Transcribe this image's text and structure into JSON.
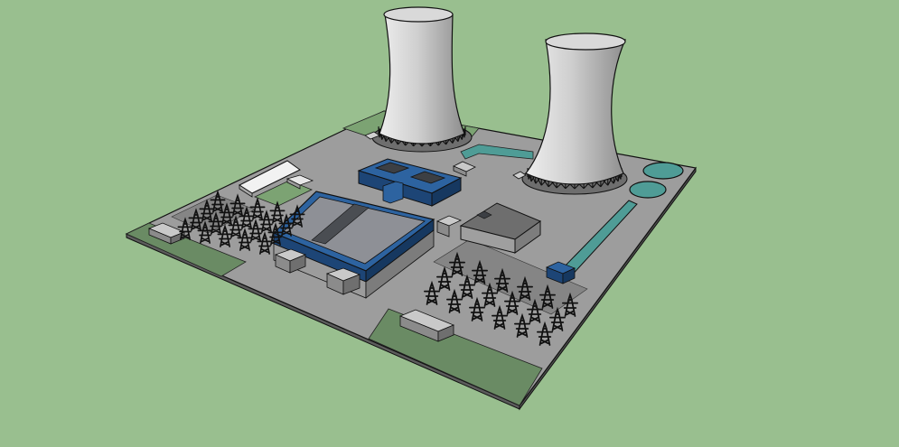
{
  "scene": {
    "kind": "3d-model-render",
    "subject": "power-plant-site",
    "palette": {
      "background": "#99bf8f",
      "lawn": "#6a8b64",
      "lawn_light": "#7ca373",
      "site_top": "#9d9d9d",
      "site_side": "#5c5c5c",
      "road": "#858585",
      "building_blue": "#2d63a0",
      "building_blue_dark": "#1d4576",
      "roof_grey": "#8e9096",
      "roof_stripe": "#4a4d52",
      "tower_light": "#e6e6e6",
      "tower_mid": "#b9b9b9",
      "tower_dark": "#8a8a8a",
      "water": "#4f9c96",
      "pylon": "#1a1a1a",
      "outline": "#111111"
    },
    "cooling_towers": 2,
    "pylon_groups": 2,
    "water_basins": 3
  }
}
